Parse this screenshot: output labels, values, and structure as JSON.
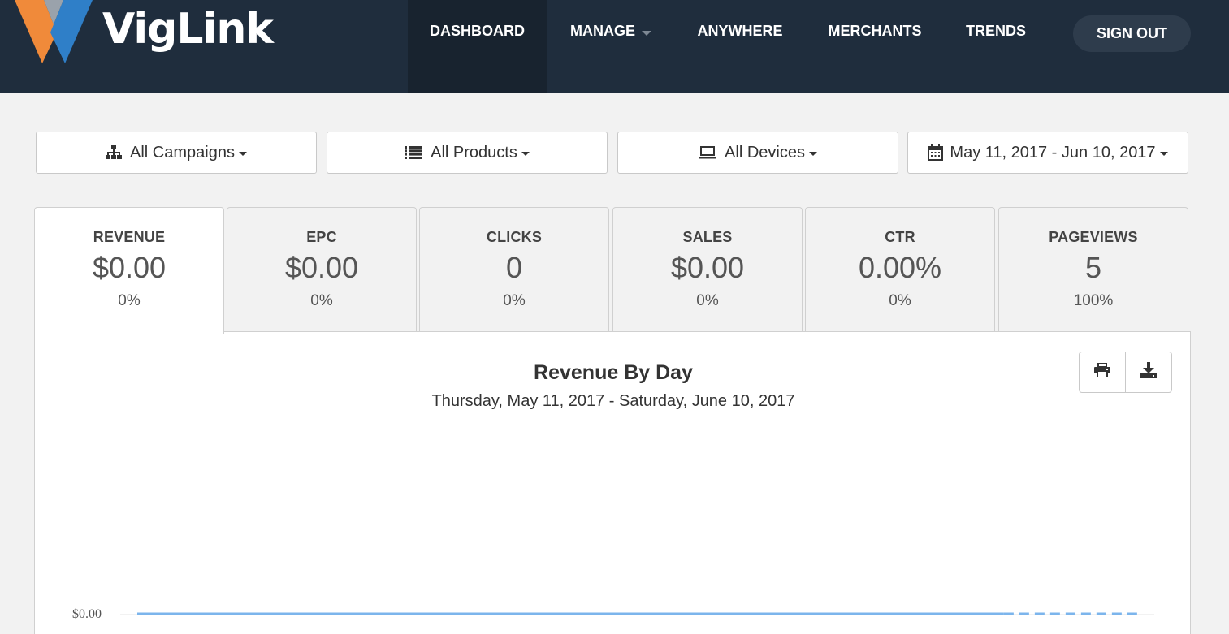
{
  "app": {
    "logo_text": "VigLink"
  },
  "nav": {
    "items": [
      {
        "label": "DASHBOARD",
        "active": true
      },
      {
        "label": "MANAGE",
        "has_dropdown": true
      },
      {
        "label": "ANYWHERE"
      },
      {
        "label": "MERCHANTS"
      },
      {
        "label": "TRENDS"
      }
    ],
    "sign_out": "SIGN OUT"
  },
  "filters": {
    "campaigns": {
      "label": "All Campaigns",
      "icon": "sitemap-icon"
    },
    "products": {
      "label": "All Products",
      "icon": "list-icon"
    },
    "devices": {
      "label": "All Devices",
      "icon": "laptop-icon"
    },
    "date_range": {
      "label": "May 11, 2017 - Jun 10, 2017",
      "icon": "calendar-icon"
    }
  },
  "metrics": [
    {
      "label": "REVENUE",
      "value": "$0.00",
      "change": "0%",
      "active": true
    },
    {
      "label": "EPC",
      "value": "$0.00",
      "change": "0%"
    },
    {
      "label": "CLICKS",
      "value": "0",
      "change": "0%"
    },
    {
      "label": "SALES",
      "value": "$0.00",
      "change": "0%"
    },
    {
      "label": "CTR",
      "value": "0.00%",
      "change": "0%"
    },
    {
      "label": "PAGEVIEWS",
      "value": "5",
      "change": "100%"
    }
  ],
  "chart": {
    "title": "Revenue By Day",
    "subtitle": "Thursday, May 11, 2017 - Saturday, June 10, 2017",
    "actions": [
      "print-icon",
      "download-icon"
    ]
  },
  "chart_data": {
    "type": "line",
    "title": "Revenue By Day",
    "subtitle": "Thursday, May 11, 2017 - Saturday, June 10, 2017",
    "y_tick_labels": [
      "$0.00"
    ],
    "series": [
      {
        "values": [
          0,
          0,
          0,
          0,
          0,
          0,
          0,
          0,
          0,
          0,
          0,
          0,
          0,
          0,
          0,
          0,
          0,
          0,
          0,
          0,
          0,
          0,
          0,
          0,
          0,
          0,
          0,
          0,
          0,
          0,
          0
        ],
        "projected_from_index": 26
      }
    ],
    "color": "#7cb5ec"
  }
}
